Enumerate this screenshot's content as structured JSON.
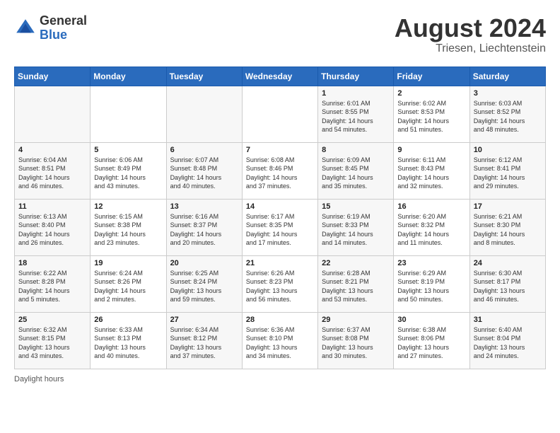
{
  "logo": {
    "general": "General",
    "blue": "Blue"
  },
  "header": {
    "month": "August 2024",
    "location": "Triesen, Liechtenstein"
  },
  "weekdays": [
    "Sunday",
    "Monday",
    "Tuesday",
    "Wednesday",
    "Thursday",
    "Friday",
    "Saturday"
  ],
  "weeks": [
    [
      {
        "day": "",
        "info": ""
      },
      {
        "day": "",
        "info": ""
      },
      {
        "day": "",
        "info": ""
      },
      {
        "day": "",
        "info": ""
      },
      {
        "day": "1",
        "info": "Sunrise: 6:01 AM\nSunset: 8:55 PM\nDaylight: 14 hours\nand 54 minutes."
      },
      {
        "day": "2",
        "info": "Sunrise: 6:02 AM\nSunset: 8:53 PM\nDaylight: 14 hours\nand 51 minutes."
      },
      {
        "day": "3",
        "info": "Sunrise: 6:03 AM\nSunset: 8:52 PM\nDaylight: 14 hours\nand 48 minutes."
      }
    ],
    [
      {
        "day": "4",
        "info": "Sunrise: 6:04 AM\nSunset: 8:51 PM\nDaylight: 14 hours\nand 46 minutes."
      },
      {
        "day": "5",
        "info": "Sunrise: 6:06 AM\nSunset: 8:49 PM\nDaylight: 14 hours\nand 43 minutes."
      },
      {
        "day": "6",
        "info": "Sunrise: 6:07 AM\nSunset: 8:48 PM\nDaylight: 14 hours\nand 40 minutes."
      },
      {
        "day": "7",
        "info": "Sunrise: 6:08 AM\nSunset: 8:46 PM\nDaylight: 14 hours\nand 37 minutes."
      },
      {
        "day": "8",
        "info": "Sunrise: 6:09 AM\nSunset: 8:45 PM\nDaylight: 14 hours\nand 35 minutes."
      },
      {
        "day": "9",
        "info": "Sunrise: 6:11 AM\nSunset: 8:43 PM\nDaylight: 14 hours\nand 32 minutes."
      },
      {
        "day": "10",
        "info": "Sunrise: 6:12 AM\nSunset: 8:41 PM\nDaylight: 14 hours\nand 29 minutes."
      }
    ],
    [
      {
        "day": "11",
        "info": "Sunrise: 6:13 AM\nSunset: 8:40 PM\nDaylight: 14 hours\nand 26 minutes."
      },
      {
        "day": "12",
        "info": "Sunrise: 6:15 AM\nSunset: 8:38 PM\nDaylight: 14 hours\nand 23 minutes."
      },
      {
        "day": "13",
        "info": "Sunrise: 6:16 AM\nSunset: 8:37 PM\nDaylight: 14 hours\nand 20 minutes."
      },
      {
        "day": "14",
        "info": "Sunrise: 6:17 AM\nSunset: 8:35 PM\nDaylight: 14 hours\nand 17 minutes."
      },
      {
        "day": "15",
        "info": "Sunrise: 6:19 AM\nSunset: 8:33 PM\nDaylight: 14 hours\nand 14 minutes."
      },
      {
        "day": "16",
        "info": "Sunrise: 6:20 AM\nSunset: 8:32 PM\nDaylight: 14 hours\nand 11 minutes."
      },
      {
        "day": "17",
        "info": "Sunrise: 6:21 AM\nSunset: 8:30 PM\nDaylight: 14 hours\nand 8 minutes."
      }
    ],
    [
      {
        "day": "18",
        "info": "Sunrise: 6:22 AM\nSunset: 8:28 PM\nDaylight: 14 hours\nand 5 minutes."
      },
      {
        "day": "19",
        "info": "Sunrise: 6:24 AM\nSunset: 8:26 PM\nDaylight: 14 hours\nand 2 minutes."
      },
      {
        "day": "20",
        "info": "Sunrise: 6:25 AM\nSunset: 8:24 PM\nDaylight: 13 hours\nand 59 minutes."
      },
      {
        "day": "21",
        "info": "Sunrise: 6:26 AM\nSunset: 8:23 PM\nDaylight: 13 hours\nand 56 minutes."
      },
      {
        "day": "22",
        "info": "Sunrise: 6:28 AM\nSunset: 8:21 PM\nDaylight: 13 hours\nand 53 minutes."
      },
      {
        "day": "23",
        "info": "Sunrise: 6:29 AM\nSunset: 8:19 PM\nDaylight: 13 hours\nand 50 minutes."
      },
      {
        "day": "24",
        "info": "Sunrise: 6:30 AM\nSunset: 8:17 PM\nDaylight: 13 hours\nand 46 minutes."
      }
    ],
    [
      {
        "day": "25",
        "info": "Sunrise: 6:32 AM\nSunset: 8:15 PM\nDaylight: 13 hours\nand 43 minutes."
      },
      {
        "day": "26",
        "info": "Sunrise: 6:33 AM\nSunset: 8:13 PM\nDaylight: 13 hours\nand 40 minutes."
      },
      {
        "day": "27",
        "info": "Sunrise: 6:34 AM\nSunset: 8:12 PM\nDaylight: 13 hours\nand 37 minutes."
      },
      {
        "day": "28",
        "info": "Sunrise: 6:36 AM\nSunset: 8:10 PM\nDaylight: 13 hours\nand 34 minutes."
      },
      {
        "day": "29",
        "info": "Sunrise: 6:37 AM\nSunset: 8:08 PM\nDaylight: 13 hours\nand 30 minutes."
      },
      {
        "day": "30",
        "info": "Sunrise: 6:38 AM\nSunset: 8:06 PM\nDaylight: 13 hours\nand 27 minutes."
      },
      {
        "day": "31",
        "info": "Sunrise: 6:40 AM\nSunset: 8:04 PM\nDaylight: 13 hours\nand 24 minutes."
      }
    ]
  ],
  "footer": {
    "text": "Daylight hours"
  }
}
